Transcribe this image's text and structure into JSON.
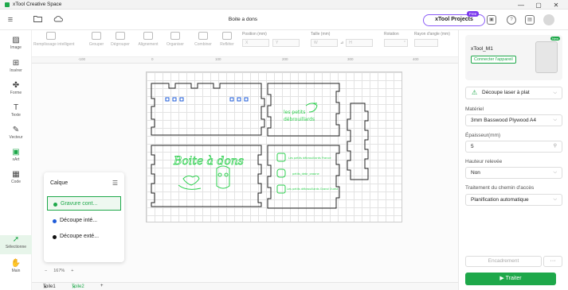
{
  "window": {
    "app_title": "xTool Creative Space",
    "controls": {
      "minimize": "—",
      "maximize": "▢",
      "close": "✕"
    }
  },
  "header": {
    "doc_title": "Boite a dons",
    "projects_label": "xTool Projects",
    "projects_badge": "Free"
  },
  "toolbar": {
    "tools": [
      {
        "label": "Remplissage intelligent",
        "icon": "fill-icon"
      },
      {
        "label": "Grouper",
        "icon": "group-icon"
      },
      {
        "label": "Dégrouper",
        "icon": "ungroup-icon"
      },
      {
        "label": "Alignement",
        "icon": "align-icon"
      },
      {
        "label": "Organiser",
        "icon": "arrange-icon"
      },
      {
        "label": "Combiner",
        "icon": "combine-icon"
      },
      {
        "label": "Refléter",
        "icon": "mirror-icon"
      }
    ],
    "position_label": "Position (mm)",
    "x_placeholder": "X",
    "y_placeholder": "Y",
    "size_label": "Taille (mm)",
    "w_placeholder": "W",
    "h_placeholder": "H",
    "rotation_label": "Rotation",
    "rotation_value": "°",
    "radius_label": "Rayon d'angle (mm)"
  },
  "ruler": {
    "ticks": [
      "-100",
      "0",
      "100",
      "200",
      "300",
      "400"
    ]
  },
  "sidebar": {
    "items": [
      {
        "label": "Image",
        "icon": "image-icon"
      },
      {
        "label": "Insérer",
        "icon": "insert-icon"
      },
      {
        "label": "Forme",
        "icon": "shape-icon"
      },
      {
        "label": "Texte",
        "icon": "text-icon"
      },
      {
        "label": "Vecteur",
        "icon": "pen-icon"
      },
      {
        "label": "xArt",
        "icon": "ai-art-icon"
      },
      {
        "label": "Code",
        "icon": "qr-code-icon"
      },
      {
        "label": "Sélectionne",
        "icon": "select-icon"
      },
      {
        "label": "Main",
        "icon": "hand-icon"
      }
    ]
  },
  "design": {
    "title_text": "Boite à dons",
    "logo_text_1": "les petits",
    "logo_text_2": "débrouillards",
    "social": [
      "Les petits débrouillards France",
      "petits_debr_oraone",
      "Les petits débrouillards Grand Ouest"
    ]
  },
  "layers": {
    "title": "Calque",
    "items": [
      {
        "label": "Gravure cont...",
        "color": "#1ea84a",
        "selected": true
      },
      {
        "label": "Découpe inté...",
        "color": "#1e5bd8",
        "selected": false
      },
      {
        "label": "Découpe exté...",
        "color": "#111111",
        "selected": false
      }
    ]
  },
  "zoom": {
    "minus": "−",
    "value": "167%",
    "plus": "+"
  },
  "tabs": [
    {
      "label": "Toile1",
      "active": false
    },
    {
      "label": "Toile2",
      "active": true
    }
  ],
  "tabs_add": "+",
  "panel": {
    "device_name": "xTool_M1",
    "connect_label": "Connecter l'appareil",
    "device_badge": "New",
    "mode": "Découpe laser à plat",
    "material_label": "Matériel",
    "material_value": "3mm Basswood Plywood A4",
    "thickness_label": "Épaisseur(mm)",
    "thickness_value": "5",
    "lift_label": "Hauteur relevée",
    "lift_value": "Non",
    "path_label": "Traitement du chemin d'accès",
    "path_value": "Planification automatique",
    "frame_label": "Encadrement",
    "more_label": "···",
    "process_label": "Traiter"
  },
  "colors": {
    "accent": "#1ea84a",
    "engrave": "#2bd04c",
    "purple": "#8b5cf6",
    "cut_inner": "#1e5bd8"
  }
}
